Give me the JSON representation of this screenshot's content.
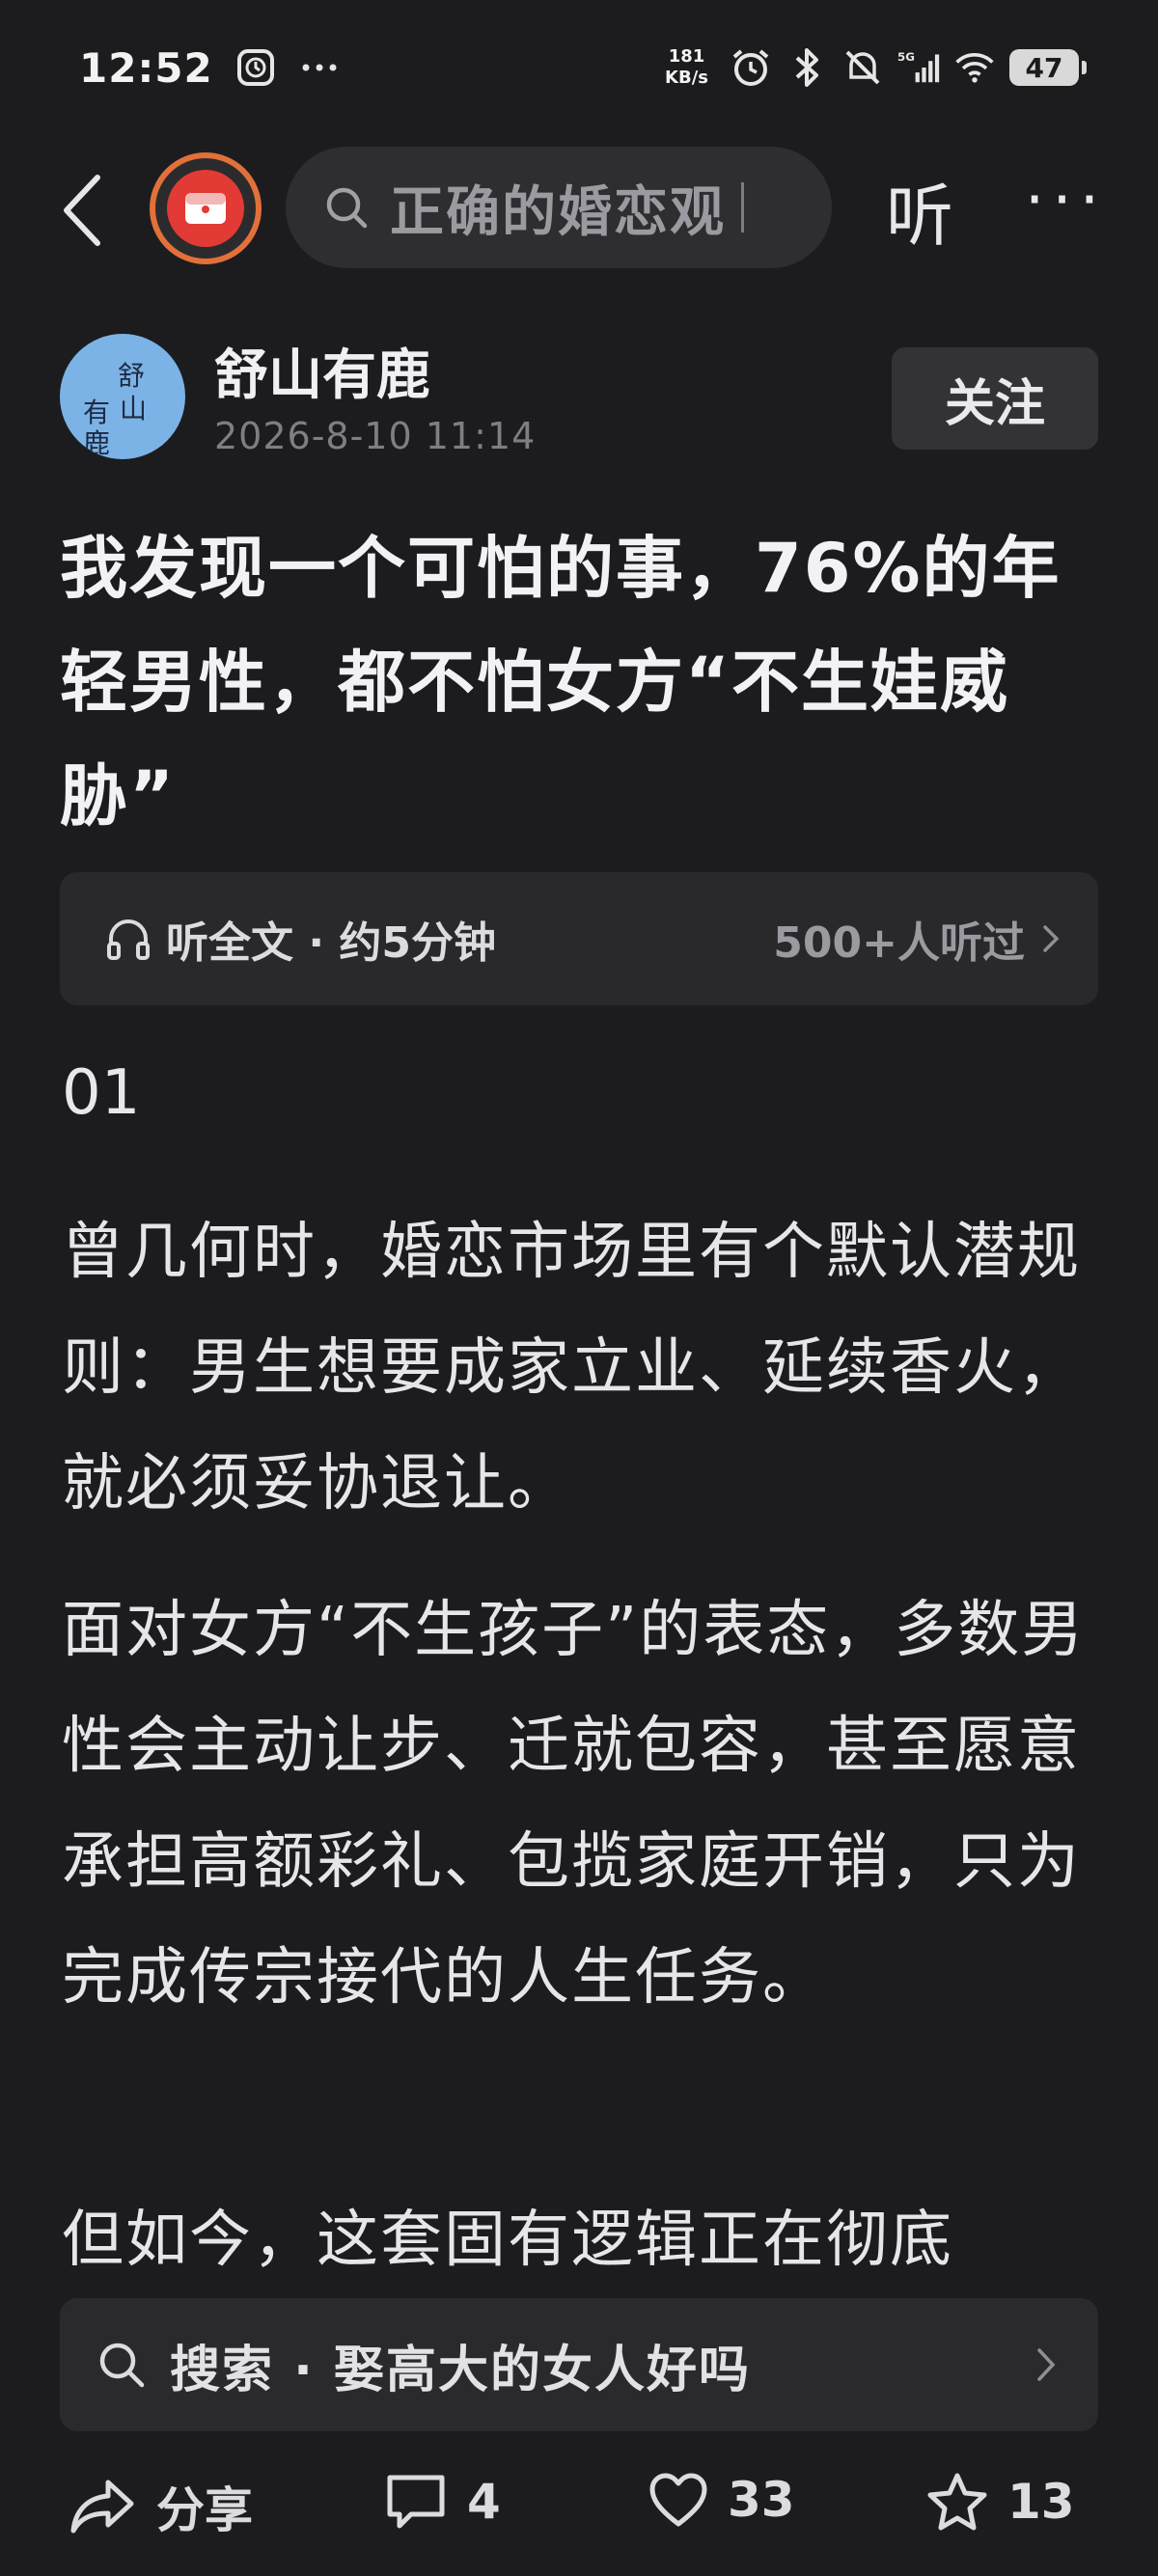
{
  "status_bar": {
    "time": "12:52",
    "net_speed_value": "181",
    "net_speed_unit": "KB/s",
    "signal_label": "5G",
    "battery": "47",
    "icons": [
      "timer-icon",
      "more-dots-icon",
      "alarm-icon",
      "bluetooth-icon",
      "mute-icon",
      "signal-icon",
      "wifi-icon",
      "battery-icon"
    ]
  },
  "nav": {
    "search_text": "正确的婚恋观",
    "listen_label": "听",
    "more_label": "···"
  },
  "author": {
    "name": "舒山有鹿",
    "date": "2026-8-10 11:14",
    "follow_label": "关注",
    "avatar_chars": [
      "舒",
      "山",
      "有",
      "鹿"
    ]
  },
  "article": {
    "title": "我发现一个可怕的事，76%的年轻男性，都不怕女方“不生娃威胁”",
    "listen_card": {
      "label": "听全文 · 约5分钟",
      "count": "500+人听过"
    },
    "section_number": "01",
    "paragraphs": [
      "曾几何时，婚恋市场里有个默认潜规则：男生想要成家立业、延续香火，就必须妥协退让。",
      "面对女方“不生孩子”的表态，多数男性会主动让步、迁就包容，甚至愿意承担高额彩礼、包揽家庭开销，只为完成传宗接代的人生任务。",
      "但如今，这套固有逻辑正在彻底"
    ]
  },
  "related_search": {
    "prefix": "搜索",
    "separator": "·",
    "query": "娶高大的女人好吗"
  },
  "actions": {
    "share_label": "分享",
    "comment_count": "4",
    "like_count": "33",
    "favorite_count": "13"
  },
  "colors": {
    "background": "#1c1c1e",
    "card": "#2a2a2d",
    "logo_ring": "#e2703a",
    "logo_fill": "#e23a35"
  }
}
